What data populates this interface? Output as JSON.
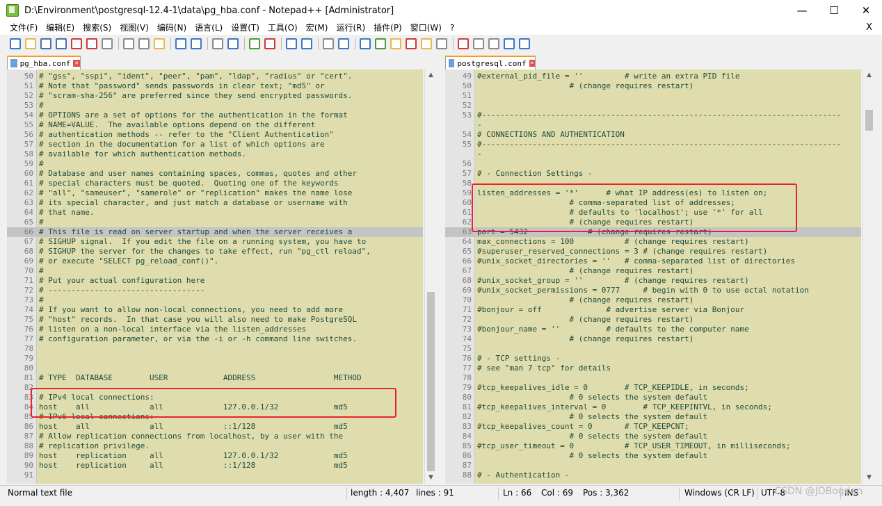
{
  "window": {
    "title": "D:\\Environment\\postgresql-12.4-1\\data\\pg_hba.conf - Notepad++ [Administrator]",
    "controls": [
      "—",
      "☐",
      "✕"
    ]
  },
  "menu": {
    "items": [
      "文件(F)",
      "编辑(E)",
      "搜索(S)",
      "视图(V)",
      "编码(N)",
      "语言(L)",
      "设置(T)",
      "工具(O)",
      "宏(M)",
      "运行(R)",
      "插件(P)",
      "窗口(W)",
      "?"
    ],
    "close": "X"
  },
  "toolbar": {
    "icons": [
      "new-file-icon",
      "open-file-icon",
      "save-icon",
      "save-all-icon",
      "close-icon",
      "close-all-icon",
      "print-icon",
      "sep",
      "cut-icon",
      "copy-icon",
      "paste-icon",
      "sep",
      "undo-icon",
      "redo-icon",
      "sep",
      "find-icon",
      "replace-icon",
      "sep",
      "zoom-in-icon",
      "zoom-out-icon",
      "sep",
      "sync-v-icon",
      "sync-h-icon",
      "sep",
      "wrap-icon",
      "all-chars-icon",
      "sep",
      "indent-guide-icon",
      "udl-icon",
      "doc-map-icon",
      "function-list-icon",
      "folder-icon",
      "monitor-icon",
      "sep",
      "record-icon",
      "stop-icon",
      "play-icon",
      "play-multi-icon",
      "save-macro-icon"
    ],
    "colors": {
      "save": "#4a6fb5",
      "red": "#d23a3a",
      "green": "#4b9b3a",
      "gray": "#8c8c8c",
      "yellow": "#e8b84a",
      "blue": "#3a78c8"
    }
  },
  "left_tab": {
    "label": "pg_hba.conf"
  },
  "right_tab": {
    "label": "postgresql.conf"
  },
  "left_lines": [
    {
      "n": "50",
      "t": "# \"gss\", \"sspi\", \"ident\", \"peer\", \"pam\", \"ldap\", \"radius\" or \"cert\"."
    },
    {
      "n": "51",
      "t": "# Note that \"password\" sends passwords in clear text; \"md5\" or"
    },
    {
      "n": "52",
      "t": "# \"scram-sha-256\" are preferred since they send encrypted passwords."
    },
    {
      "n": "53",
      "t": "#"
    },
    {
      "n": "54",
      "t": "# OPTIONS are a set of options for the authentication in the format"
    },
    {
      "n": "55",
      "t": "# NAME=VALUE.  The available options depend on the different"
    },
    {
      "n": "56",
      "t": "# authentication methods -- refer to the \"Client Authentication\""
    },
    {
      "n": "57",
      "t": "# section in the documentation for a list of which options are"
    },
    {
      "n": "58",
      "t": "# available for which authentication methods."
    },
    {
      "n": "59",
      "t": "#"
    },
    {
      "n": "60",
      "t": "# Database and user names containing spaces, commas, quotes and other"
    },
    {
      "n": "61",
      "t": "# special characters must be quoted.  Quoting one of the keywords"
    },
    {
      "n": "62",
      "t": "# \"all\", \"sameuser\", \"samerole\" or \"replication\" makes the name lose"
    },
    {
      "n": "63",
      "t": "# its special character, and just match a database or username with"
    },
    {
      "n": "64",
      "t": "# that name."
    },
    {
      "n": "65",
      "t": "#"
    },
    {
      "n": "66",
      "t": "# This file is read on server startup and when the server receives a",
      "hl": true
    },
    {
      "n": "67",
      "t": "# SIGHUP signal.  If you edit the file on a running system, you have to"
    },
    {
      "n": "68",
      "t": "# SIGHUP the server for the changes to take effect, run \"pg_ctl reload\","
    },
    {
      "n": "69",
      "t": "# or execute \"SELECT pg_reload_conf()\"."
    },
    {
      "n": "70",
      "t": "#"
    },
    {
      "n": "71",
      "t": "# Put your actual configuration here"
    },
    {
      "n": "72",
      "t": "# ----------------------------------"
    },
    {
      "n": "73",
      "t": "#"
    },
    {
      "n": "74",
      "t": "# If you want to allow non-local connections, you need to add more"
    },
    {
      "n": "75",
      "t": "# \"host\" records.  In that case you will also need to make PostgreSQL"
    },
    {
      "n": "76",
      "t": "# listen on a non-local interface via the listen_addresses"
    },
    {
      "n": "77",
      "t": "# configuration parameter, or via the -i or -h command line switches."
    },
    {
      "n": "78",
      "t": ""
    },
    {
      "n": "79",
      "t": ""
    },
    {
      "n": "80",
      "t": ""
    },
    {
      "n": "81",
      "t": "# TYPE  DATABASE        USER            ADDRESS                 METHOD"
    },
    {
      "n": "82",
      "t": ""
    },
    {
      "n": "83",
      "t": "# IPv4 local connections:"
    },
    {
      "n": "84",
      "t": "host    all             all             127.0.0.1/32            md5"
    },
    {
      "n": "85",
      "t": "# IPv6 local connections:"
    },
    {
      "n": "86",
      "t": "host    all             all             ::1/128                 md5"
    },
    {
      "n": "87",
      "t": "# Allow replication connections from localhost, by a user with the"
    },
    {
      "n": "88",
      "t": "# replication privilege."
    },
    {
      "n": "89",
      "t": "host    replication     all             127.0.0.1/32            md5"
    },
    {
      "n": "90",
      "t": "host    replication     all             ::1/128                 md5"
    },
    {
      "n": "91",
      "t": ""
    }
  ],
  "right_lines": [
    {
      "n": "49",
      "t": "#external_pid_file = ''         # write an extra PID file"
    },
    {
      "n": "50",
      "t": "                    # (change requires restart)"
    },
    {
      "n": "51",
      "t": ""
    },
    {
      "n": "52",
      "t": ""
    },
    {
      "n": "53",
      "t": "#------------------------------------------------------------------------------"
    },
    {
      "n": "",
      "t": "-"
    },
    {
      "n": "54",
      "t": "# CONNECTIONS AND AUTHENTICATION"
    },
    {
      "n": "55",
      "t": "#------------------------------------------------------------------------------"
    },
    {
      "n": "",
      "t": "-"
    },
    {
      "n": "56",
      "t": ""
    },
    {
      "n": "57",
      "t": "# - Connection Settings -"
    },
    {
      "n": "58",
      "t": ""
    },
    {
      "n": "59",
      "t": "listen_addresses = '*'      # what IP address(es) to listen on;"
    },
    {
      "n": "60",
      "t": "                    # comma-separated list of addresses;"
    },
    {
      "n": "61",
      "t": "                    # defaults to 'localhost'; use '*' for all"
    },
    {
      "n": "62",
      "t": "                    # (change requires restart)"
    },
    {
      "n": "63",
      "t": "port = 5432             # (change requires restart)",
      "hl": true
    },
    {
      "n": "64",
      "t": "max_connections = 100           # (change requires restart)"
    },
    {
      "n": "65",
      "t": "#superuser_reserved_connections = 3 # (change requires restart)"
    },
    {
      "n": "66",
      "t": "#unix_socket_directories = ''   # comma-separated list of directories"
    },
    {
      "n": "67",
      "t": "                    # (change requires restart)"
    },
    {
      "n": "68",
      "t": "#unix_socket_group = ''         # (change requires restart)"
    },
    {
      "n": "69",
      "t": "#unix_socket_permissions = 0777     # begin with 0 to use octal notation"
    },
    {
      "n": "70",
      "t": "                    # (change requires restart)"
    },
    {
      "n": "71",
      "t": "#bonjour = off              # advertise server via Bonjour"
    },
    {
      "n": "72",
      "t": "                    # (change requires restart)"
    },
    {
      "n": "73",
      "t": "#bonjour_name = ''          # defaults to the computer name"
    },
    {
      "n": "74",
      "t": "                    # (change requires restart)"
    },
    {
      "n": "75",
      "t": ""
    },
    {
      "n": "76",
      "t": "# - TCP settings -"
    },
    {
      "n": "77",
      "t": "# see \"man 7 tcp\" for details"
    },
    {
      "n": "78",
      "t": ""
    },
    {
      "n": "79",
      "t": "#tcp_keepalives_idle = 0        # TCP_KEEPIDLE, in seconds;"
    },
    {
      "n": "80",
      "t": "                    # 0 selects the system default"
    },
    {
      "n": "81",
      "t": "#tcp_keepalives_interval = 0        # TCP_KEEPINTVL, in seconds;"
    },
    {
      "n": "82",
      "t": "                    # 0 selects the system default"
    },
    {
      "n": "83",
      "t": "#tcp_keepalives_count = 0       # TCP_KEEPCNT;"
    },
    {
      "n": "84",
      "t": "                    # 0 selects the system default"
    },
    {
      "n": "85",
      "t": "#tcp_user_timeout = 0           # TCP_USER_TIMEOUT, in milliseconds;"
    },
    {
      "n": "86",
      "t": "                    # 0 selects the system default"
    },
    {
      "n": "87",
      "t": ""
    },
    {
      "n": "88",
      "t": "# - Authentication -"
    }
  ],
  "status": {
    "filetype": "Normal text file",
    "length": "length : 4,407",
    "lines": "lines : 91",
    "ln": "Ln : 66",
    "col": "Col : 69",
    "pos": "Pos : 3,362",
    "eol": "Windows (CR LF)",
    "encoding": "UTF-8",
    "mode": "INS"
  },
  "watermark": "CSDN @JDBogdan"
}
